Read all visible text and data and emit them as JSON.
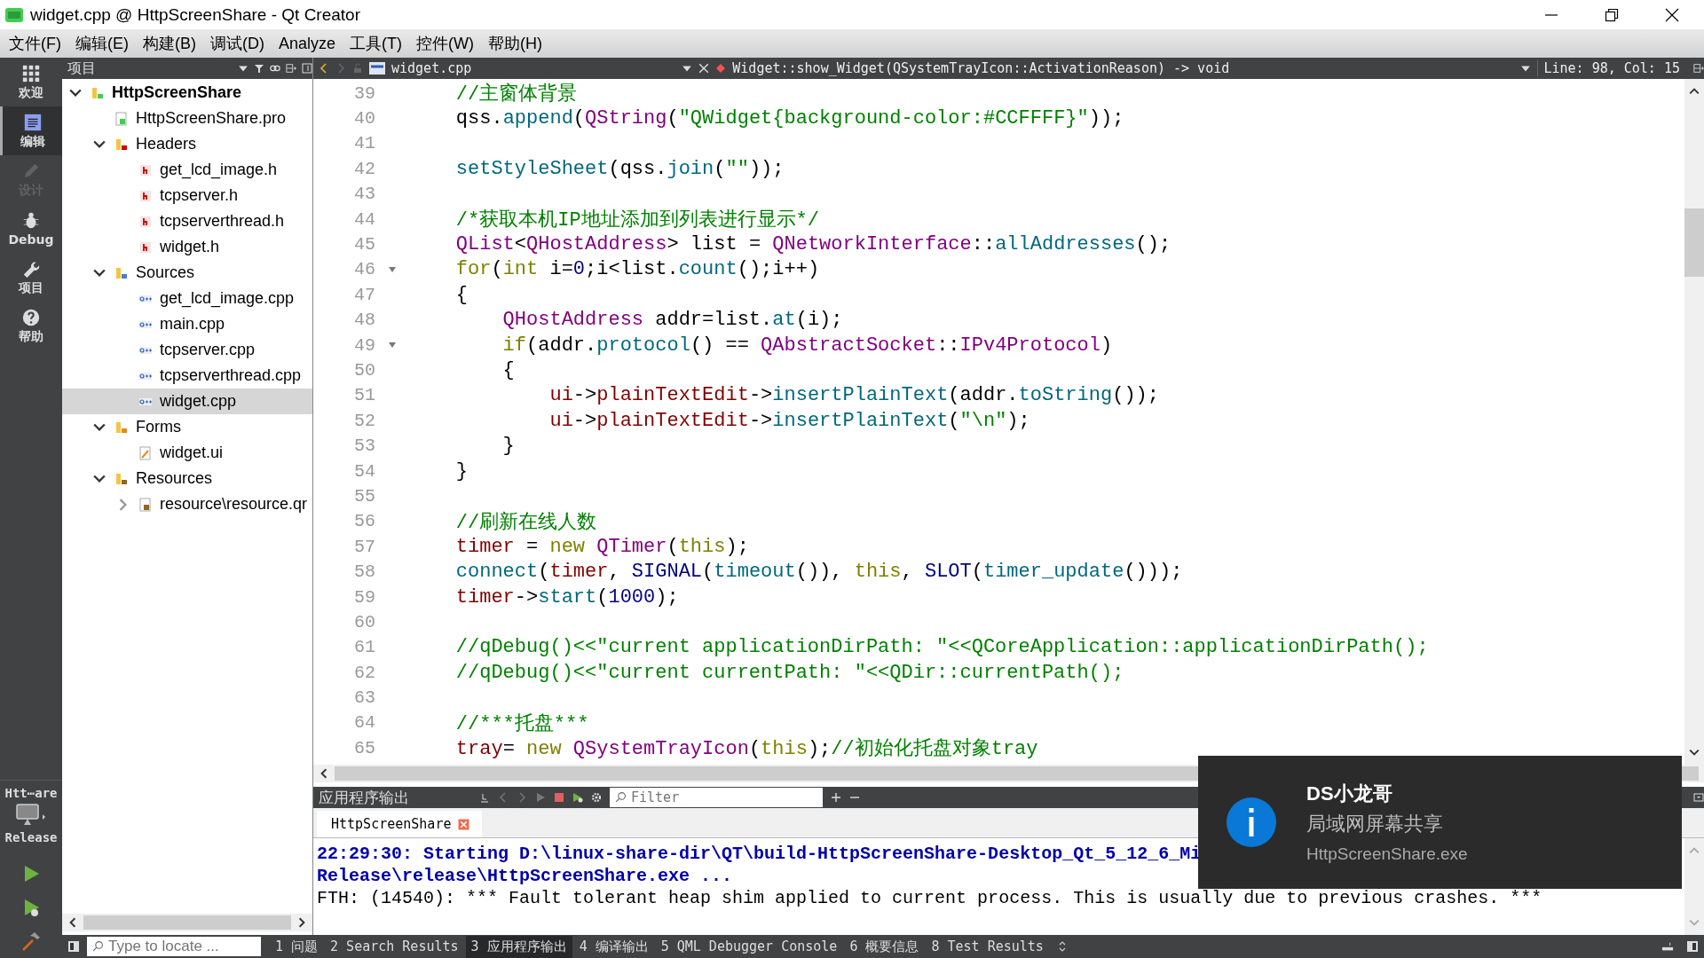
{
  "window": {
    "title": "widget.cpp @ HttpScreenShare - Qt Creator"
  },
  "menu": [
    "文件(F)",
    "编辑(E)",
    "构建(B)",
    "调试(D)",
    "Analyze",
    "工具(T)",
    "控件(W)",
    "帮助(H)"
  ],
  "modes": [
    {
      "label": "欢迎",
      "kind": "welcome",
      "selected": false,
      "disabled": false
    },
    {
      "label": "编辑",
      "kind": "edit",
      "selected": true,
      "disabled": false
    },
    {
      "label": "设计",
      "kind": "design",
      "selected": false,
      "disabled": true
    },
    {
      "label": "Debug",
      "kind": "debug",
      "selected": false,
      "disabled": false
    },
    {
      "label": "项目",
      "kind": "projects",
      "selected": false,
      "disabled": false
    },
    {
      "label": "帮助",
      "kind": "help",
      "selected": false,
      "disabled": false
    }
  ],
  "target": {
    "project": "Htt⋯are",
    "config": "Release"
  },
  "project_panel": {
    "title": "项目",
    "tree": [
      {
        "label": "HttpScreenShare",
        "kind": "project",
        "expanded": true,
        "selected": false,
        "children": [
          {
            "label": "HttpScreenShare.pro",
            "kind": "pro",
            "selected": false
          },
          {
            "label": "Headers",
            "kind": "folder-h",
            "expanded": true,
            "selected": false,
            "children": [
              {
                "label": "get_lcd_image.h",
                "kind": "header",
                "selected": false
              },
              {
                "label": "tcpserver.h",
                "kind": "header",
                "selected": false
              },
              {
                "label": "tcpserverthread.h",
                "kind": "header",
                "selected": false
              },
              {
                "label": "widget.h",
                "kind": "header",
                "selected": false
              }
            ]
          },
          {
            "label": "Sources",
            "kind": "folder-cpp",
            "expanded": true,
            "selected": false,
            "children": [
              {
                "label": "get_lcd_image.cpp",
                "kind": "source",
                "selected": false
              },
              {
                "label": "main.cpp",
                "kind": "source",
                "selected": false
              },
              {
                "label": "tcpserver.cpp",
                "kind": "source",
                "selected": false
              },
              {
                "label": "tcpserverthread.cpp",
                "kind": "source",
                "selected": false
              },
              {
                "label": "widget.cpp",
                "kind": "source",
                "selected": true
              }
            ]
          },
          {
            "label": "Forms",
            "kind": "folder-form",
            "expanded": true,
            "selected": false,
            "children": [
              {
                "label": "widget.ui",
                "kind": "form",
                "selected": false
              }
            ]
          },
          {
            "label": "Resources",
            "kind": "folder-res",
            "expanded": true,
            "selected": false,
            "children": [
              {
                "label": "resource\\resource.qr",
                "kind": "qrc",
                "expanded": false,
                "selected": false
              }
            ]
          }
        ]
      }
    ]
  },
  "editor": {
    "file": "widget.cpp",
    "symbol": "Widget::show_Widget(QSystemTrayIcon::ActivationReason) -> void",
    "position": "Line: 98, Col: 15",
    "lines": [
      {
        "num": "39",
        "fold": false,
        "tokens": [
          {
            "kind": "comment",
            "text": "    //主窗体背景"
          }
        ]
      },
      {
        "num": "40",
        "fold": false,
        "tokens": [
          {
            "kind": "plain",
            "text": "    qss."
          },
          {
            "kind": "func",
            "text": "append"
          },
          {
            "kind": "plain",
            "text": "("
          },
          {
            "kind": "type",
            "text": "QString"
          },
          {
            "kind": "plain",
            "text": "("
          },
          {
            "kind": "string",
            "text": "\"QWidget{background-color:#CCFFFF}\""
          },
          {
            "kind": "plain",
            "text": "));"
          }
        ]
      },
      {
        "num": "41",
        "fold": false
      },
      {
        "num": "42",
        "fold": false,
        "tokens": [
          {
            "kind": "func",
            "text": "    setStyleSheet"
          },
          {
            "kind": "plain",
            "text": "(qss."
          },
          {
            "kind": "func",
            "text": "join"
          },
          {
            "kind": "plain",
            "text": "("
          },
          {
            "kind": "string",
            "text": "\"\""
          },
          {
            "kind": "plain",
            "text": "));"
          }
        ]
      },
      {
        "num": "43",
        "fold": false
      },
      {
        "num": "44",
        "fold": false,
        "tokens": [
          {
            "kind": "comment",
            "text": "    /*获取本机IP地址添加到列表进行显示*/"
          }
        ]
      },
      {
        "num": "45",
        "fold": false,
        "tokens": [
          {
            "kind": "type",
            "text": "    QList"
          },
          {
            "kind": "plain",
            "text": "<"
          },
          {
            "kind": "type",
            "text": "QHostAddress"
          },
          {
            "kind": "plain",
            "text": "> list = "
          },
          {
            "kind": "type",
            "text": "QNetworkInterface"
          },
          {
            "kind": "plain",
            "text": "::"
          },
          {
            "kind": "func",
            "text": "allAddresses"
          },
          {
            "kind": "plain",
            "text": "();"
          }
        ]
      },
      {
        "num": "46",
        "fold": true,
        "tokens": [
          {
            "kind": "keyword",
            "text": "    for"
          },
          {
            "kind": "plain",
            "text": "("
          },
          {
            "kind": "keyword",
            "text": "int"
          },
          {
            "kind": "plain",
            "text": " i="
          },
          {
            "kind": "number",
            "text": "0"
          },
          {
            "kind": "plain",
            "text": ";i<list."
          },
          {
            "kind": "func",
            "text": "count"
          },
          {
            "kind": "plain",
            "text": "();i++)"
          }
        ]
      },
      {
        "num": "47",
        "fold": false,
        "tokens": [
          {
            "kind": "plain",
            "text": "    {"
          }
        ]
      },
      {
        "num": "48",
        "fold": false,
        "tokens": [
          {
            "kind": "type",
            "text": "        QHostAddress"
          },
          {
            "kind": "plain",
            "text": " addr=list."
          },
          {
            "kind": "func",
            "text": "at"
          },
          {
            "kind": "plain",
            "text": "(i);"
          }
        ]
      },
      {
        "num": "49",
        "fold": true,
        "tokens": [
          {
            "kind": "keyword",
            "text": "        if"
          },
          {
            "kind": "plain",
            "text": "(addr."
          },
          {
            "kind": "func",
            "text": "protocol"
          },
          {
            "kind": "plain",
            "text": "() == "
          },
          {
            "kind": "type",
            "text": "QAbstractSocket"
          },
          {
            "kind": "plain",
            "text": "::"
          },
          {
            "kind": "type",
            "text": "IPv4Protocol"
          },
          {
            "kind": "plain",
            "text": ")"
          }
        ]
      },
      {
        "num": "50",
        "fold": false,
        "tokens": [
          {
            "kind": "plain",
            "text": "        {"
          }
        ]
      },
      {
        "num": "51",
        "fold": false,
        "tokens": [
          {
            "kind": "member",
            "text": "            ui"
          },
          {
            "kind": "plain",
            "text": "->"
          },
          {
            "kind": "member",
            "text": "plainTextEdit"
          },
          {
            "kind": "plain",
            "text": "->"
          },
          {
            "kind": "func",
            "text": "insertPlainText"
          },
          {
            "kind": "plain",
            "text": "(addr."
          },
          {
            "kind": "func",
            "text": "toString"
          },
          {
            "kind": "plain",
            "text": "());"
          }
        ]
      },
      {
        "num": "52",
        "fold": false,
        "tokens": [
          {
            "kind": "member",
            "text": "            ui"
          },
          {
            "kind": "plain",
            "text": "->"
          },
          {
            "kind": "member",
            "text": "plainTextEdit"
          },
          {
            "kind": "plain",
            "text": "->"
          },
          {
            "kind": "func",
            "text": "insertPlainText"
          },
          {
            "kind": "plain",
            "text": "("
          },
          {
            "kind": "string",
            "text": "\"\\n\""
          },
          {
            "kind": "plain",
            "text": ");"
          }
        ]
      },
      {
        "num": "53",
        "fold": false,
        "tokens": [
          {
            "kind": "plain",
            "text": "        }"
          }
        ]
      },
      {
        "num": "54",
        "fold": false,
        "tokens": [
          {
            "kind": "plain",
            "text": "    }"
          }
        ]
      },
      {
        "num": "55",
        "fold": false
      },
      {
        "num": "56",
        "fold": false,
        "tokens": [
          {
            "kind": "comment",
            "text": "    //刷新在线人数"
          }
        ]
      },
      {
        "num": "57",
        "fold": false,
        "tokens": [
          {
            "kind": "member",
            "text": "    timer"
          },
          {
            "kind": "plain",
            "text": " = "
          },
          {
            "kind": "keyword",
            "text": "new "
          },
          {
            "kind": "type",
            "text": "QTimer"
          },
          {
            "kind": "plain",
            "text": "("
          },
          {
            "kind": "keyword",
            "text": "this"
          },
          {
            "kind": "plain",
            "text": ");"
          }
        ]
      },
      {
        "num": "58",
        "fold": false,
        "tokens": [
          {
            "kind": "func",
            "text": "    connect"
          },
          {
            "kind": "plain",
            "text": "("
          },
          {
            "kind": "member",
            "text": "timer"
          },
          {
            "kind": "plain",
            "text": ", "
          },
          {
            "kind": "macro",
            "text": "SIGNAL"
          },
          {
            "kind": "plain",
            "text": "("
          },
          {
            "kind": "func",
            "text": "timeout"
          },
          {
            "kind": "plain",
            "text": "()), "
          },
          {
            "kind": "keyword",
            "text": "this"
          },
          {
            "kind": "plain",
            "text": ", "
          },
          {
            "kind": "macro",
            "text": "SLOT"
          },
          {
            "kind": "plain",
            "text": "("
          },
          {
            "kind": "func",
            "text": "timer_update"
          },
          {
            "kind": "plain",
            "text": "()));"
          }
        ]
      },
      {
        "num": "59",
        "fold": false,
        "tokens": [
          {
            "kind": "member",
            "text": "    timer"
          },
          {
            "kind": "plain",
            "text": "->"
          },
          {
            "kind": "func",
            "text": "start"
          },
          {
            "kind": "plain",
            "text": "("
          },
          {
            "kind": "number",
            "text": "1000"
          },
          {
            "kind": "plain",
            "text": ");"
          }
        ]
      },
      {
        "num": "60",
        "fold": false
      },
      {
        "num": "61",
        "fold": false,
        "tokens": [
          {
            "kind": "comment",
            "text": "    //qDebug()<<\"current applicationDirPath: \"<<QCoreApplication::applicationDirPath();"
          }
        ]
      },
      {
        "num": "62",
        "fold": false,
        "tokens": [
          {
            "kind": "comment",
            "text": "    //qDebug()<<\"current currentPath: \"<<QDir::currentPath();"
          }
        ]
      },
      {
        "num": "63",
        "fold": false
      },
      {
        "num": "64",
        "fold": false,
        "tokens": [
          {
            "kind": "comment",
            "text": "    //***托盘***"
          }
        ]
      },
      {
        "num": "65",
        "fold": false,
        "tokens": [
          {
            "kind": "member",
            "text": "    tray"
          },
          {
            "kind": "plain",
            "text": "= "
          },
          {
            "kind": "keyword",
            "text": "new "
          },
          {
            "kind": "type",
            "text": "QSystemTrayIcon"
          },
          {
            "kind": "plain",
            "text": "("
          },
          {
            "kind": "keyword",
            "text": "this"
          },
          {
            "kind": "plain",
            "text": ");"
          },
          {
            "kind": "comment",
            "text": "//初始化托盘对象tray"
          }
        ]
      }
    ]
  },
  "output": {
    "title": "应用程序输出",
    "filter": {
      "placeholder": "Filter"
    },
    "tab": "HttpScreenShare",
    "lines": [
      {
        "kind": "info",
        "text": "22:29:30: Starting D:\\linux-share-dir\\QT\\build-HttpScreenShare-Desktop_Qt_5_12_6_Mi"
      },
      {
        "kind": "info",
        "text": "Release\\release\\HttpScreenShare.exe ..."
      },
      {
        "kind": "plain",
        "text": "FTH: (14540): *** Fault tolerant heap shim applied to current process. This is usually due to previous crashes. ***"
      }
    ]
  },
  "status_bar": {
    "locate": {
      "placeholder": "Type to locate ..."
    },
    "tabs": [
      {
        "label": "1 问题",
        "selected": false
      },
      {
        "label": "2 Search Results",
        "selected": false
      },
      {
        "label": "3 应用程序输出",
        "selected": true
      },
      {
        "label": "4 编译输出",
        "selected": false
      },
      {
        "label": "5 QML Debugger Console",
        "selected": false
      },
      {
        "label": "6 概要信息",
        "selected": false
      },
      {
        "label": "8 Test Results",
        "selected": false
      }
    ]
  },
  "notification": {
    "title": "DS小龙哥",
    "body": "局域网屏幕共享",
    "app": "HttpScreenShare.exe"
  }
}
